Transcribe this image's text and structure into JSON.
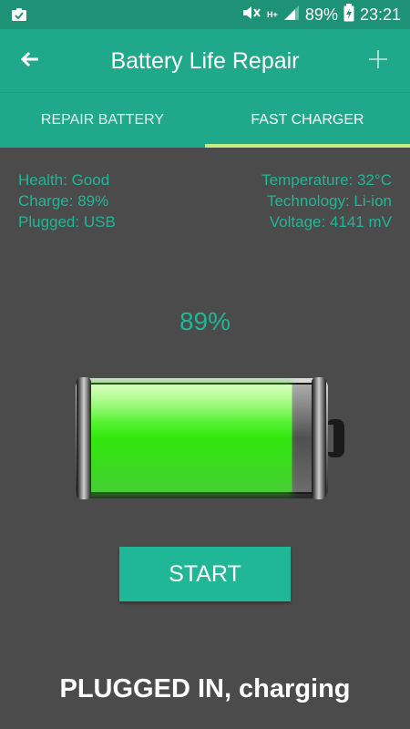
{
  "statusbar": {
    "battery_pct": "89%",
    "time": "23:21",
    "network": "H+"
  },
  "appbar": {
    "title": "Battery Life Repair",
    "back_icon": "arrow-left-icon",
    "add_icon": "plus-icon"
  },
  "tabs": [
    {
      "label": "REPAIR BATTERY",
      "active": false
    },
    {
      "label": "FAST CHARGER",
      "active": true
    }
  ],
  "info": {
    "left": [
      "Health: Good",
      "Charge: 89%",
      "Plugged: USB"
    ],
    "right": [
      "Temperature: 32°C",
      "Technology: Li-ion",
      "Voltage: 4141 mV"
    ]
  },
  "battery": {
    "percent_label": "89%",
    "level": 0.89,
    "fill_color": "#22e000"
  },
  "start_button": "START",
  "status": "PLUGGED IN, charging",
  "colors": {
    "accent": "#1fa98a",
    "text_accent": "#1fb796",
    "background": "#4b4b4b",
    "tab_indicator": "#c4ed84"
  }
}
